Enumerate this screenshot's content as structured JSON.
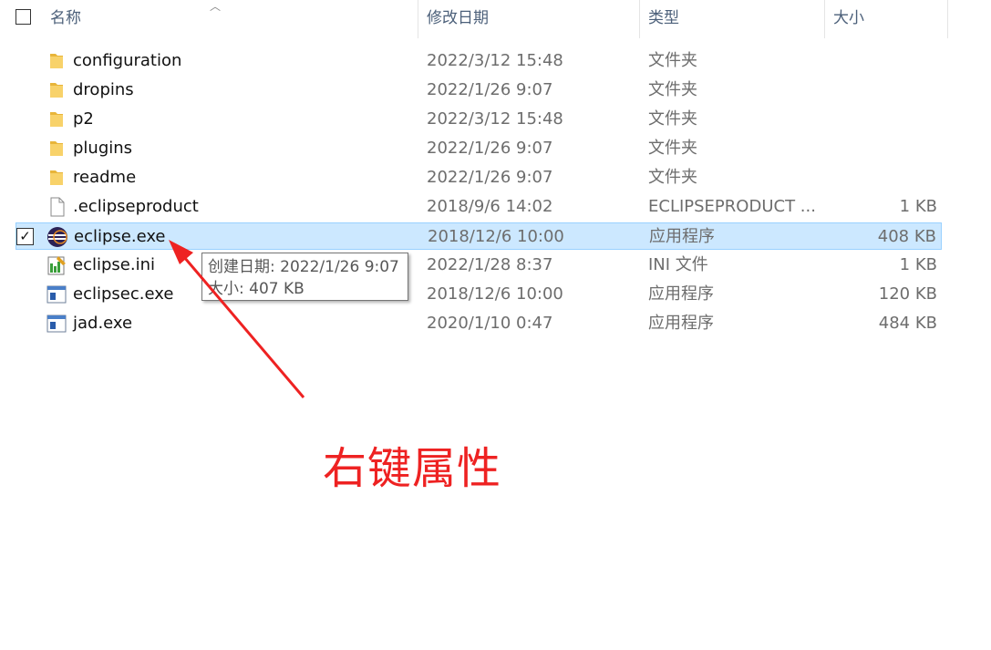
{
  "header": {
    "columns": {
      "name": "名称",
      "modified": "修改日期",
      "type": "类型",
      "size": "大小"
    }
  },
  "files": [
    {
      "name": "configuration",
      "date": "2022/3/12 15:48",
      "type": "文件夹",
      "size": "",
      "icon": "folder-icon",
      "selected": false
    },
    {
      "name": "dropins",
      "date": "2022/1/26 9:07",
      "type": "文件夹",
      "size": "",
      "icon": "folder-icon",
      "selected": false
    },
    {
      "name": "p2",
      "date": "2022/3/12 15:48",
      "type": "文件夹",
      "size": "",
      "icon": "folder-icon",
      "selected": false
    },
    {
      "name": "plugins",
      "date": "2022/1/26 9:07",
      "type": "文件夹",
      "size": "",
      "icon": "folder-icon",
      "selected": false
    },
    {
      "name": "readme",
      "date": "2022/1/26 9:07",
      "type": "文件夹",
      "size": "",
      "icon": "folder-icon",
      "selected": false
    },
    {
      "name": ".eclipseproduct",
      "date": "2018/9/6 14:02",
      "type": "ECLIPSEPRODUCT ...",
      "size": "1 KB",
      "icon": "file-icon",
      "selected": false
    },
    {
      "name": "eclipse.exe",
      "date": "2018/12/6 10:00",
      "type": "应用程序",
      "size": "408 KB",
      "icon": "eclipse-icon",
      "selected": true
    },
    {
      "name": "eclipse.ini",
      "date": "2022/1/28 8:37",
      "type": "INI 文件",
      "size": "1 KB",
      "icon": "ini-file-icon",
      "selected": false
    },
    {
      "name": "eclipsec.exe",
      "date": "2018/12/6 10:00",
      "type": "应用程序",
      "size": "120 KB",
      "icon": "app-icon",
      "selected": false
    },
    {
      "name": "jad.exe",
      "date": "2020/1/10 0:47",
      "type": "应用程序",
      "size": "484 KB",
      "icon": "app-icon",
      "selected": false
    }
  ],
  "tooltip": {
    "line1": "创建日期: 2022/1/26 9:07",
    "line2": "大小: 407 KB"
  },
  "annotation": {
    "text": "右键属性",
    "color": "#ee2222"
  },
  "colors": {
    "selection_bg": "#cce8ff",
    "selection_border": "#99d1ff",
    "folder": "#f8c94a"
  }
}
